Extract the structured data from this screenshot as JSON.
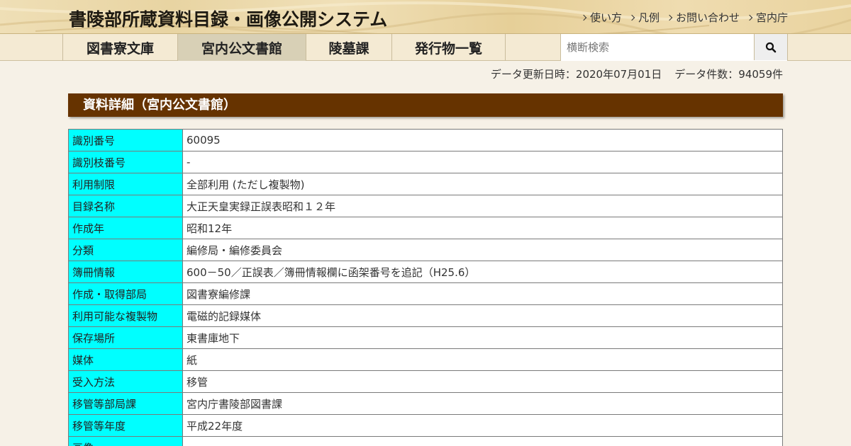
{
  "header": {
    "title": "書陵部所蔵資料目録・画像公開システム",
    "links": [
      {
        "label": "使い方",
        "icon": "chevron-right-icon"
      },
      {
        "label": "凡例",
        "icon": "chevron-right-icon"
      },
      {
        "label": "お問い合わせ",
        "icon": "chevron-right-icon"
      },
      {
        "label": "宮内庁",
        "icon": "chevron-right-icon"
      }
    ]
  },
  "nav": {
    "tabs": [
      {
        "label": "図書寮文庫",
        "active": false
      },
      {
        "label": "宮内公文書館",
        "active": true
      },
      {
        "label": "陵墓課",
        "active": false
      },
      {
        "label": "発行物一覧",
        "active": false
      }
    ],
    "search": {
      "placeholder": "横断検索",
      "value": "",
      "button_icon": "search-icon"
    }
  },
  "meta": {
    "updated": "データ更新日時：2020年07月01日",
    "count": "データ件数：94059件"
  },
  "section": {
    "title": "資料詳細（宮内公文書館）"
  },
  "details": [
    {
      "label": "識別番号",
      "value": "60095"
    },
    {
      "label": "識別枝番号",
      "value": "-"
    },
    {
      "label": "利用制限",
      "value": "全部利用 (ただし複製物)"
    },
    {
      "label": "目録名称",
      "value": "大正天皇実録正誤表昭和１２年"
    },
    {
      "label": "作成年",
      "value": "昭和12年"
    },
    {
      "label": "分類",
      "value": "編修局・編修委員会"
    },
    {
      "label": "簿冊情報",
      "value": "600－50／正誤表／簿冊情報欄に函架番号を追記（H25.6）"
    },
    {
      "label": "作成・取得部局",
      "value": "図書寮編修課"
    },
    {
      "label": "利用可能な複製物",
      "value": "電磁的記録媒体"
    },
    {
      "label": "保存場所",
      "value": "東書庫地下"
    },
    {
      "label": "媒体",
      "value": "紙"
    },
    {
      "label": "受入方法",
      "value": "移管"
    },
    {
      "label": "移管等部局課",
      "value": "宮内庁書陵部図書課"
    },
    {
      "label": "移管等年度",
      "value": "平成22年度"
    },
    {
      "label": "画像",
      "value": ""
    }
  ],
  "colors": {
    "label_bg": "#00ffff",
    "section_bg": "#663300",
    "active_tab": "#d8d0b6",
    "nav_bg": "#f4ead3"
  }
}
